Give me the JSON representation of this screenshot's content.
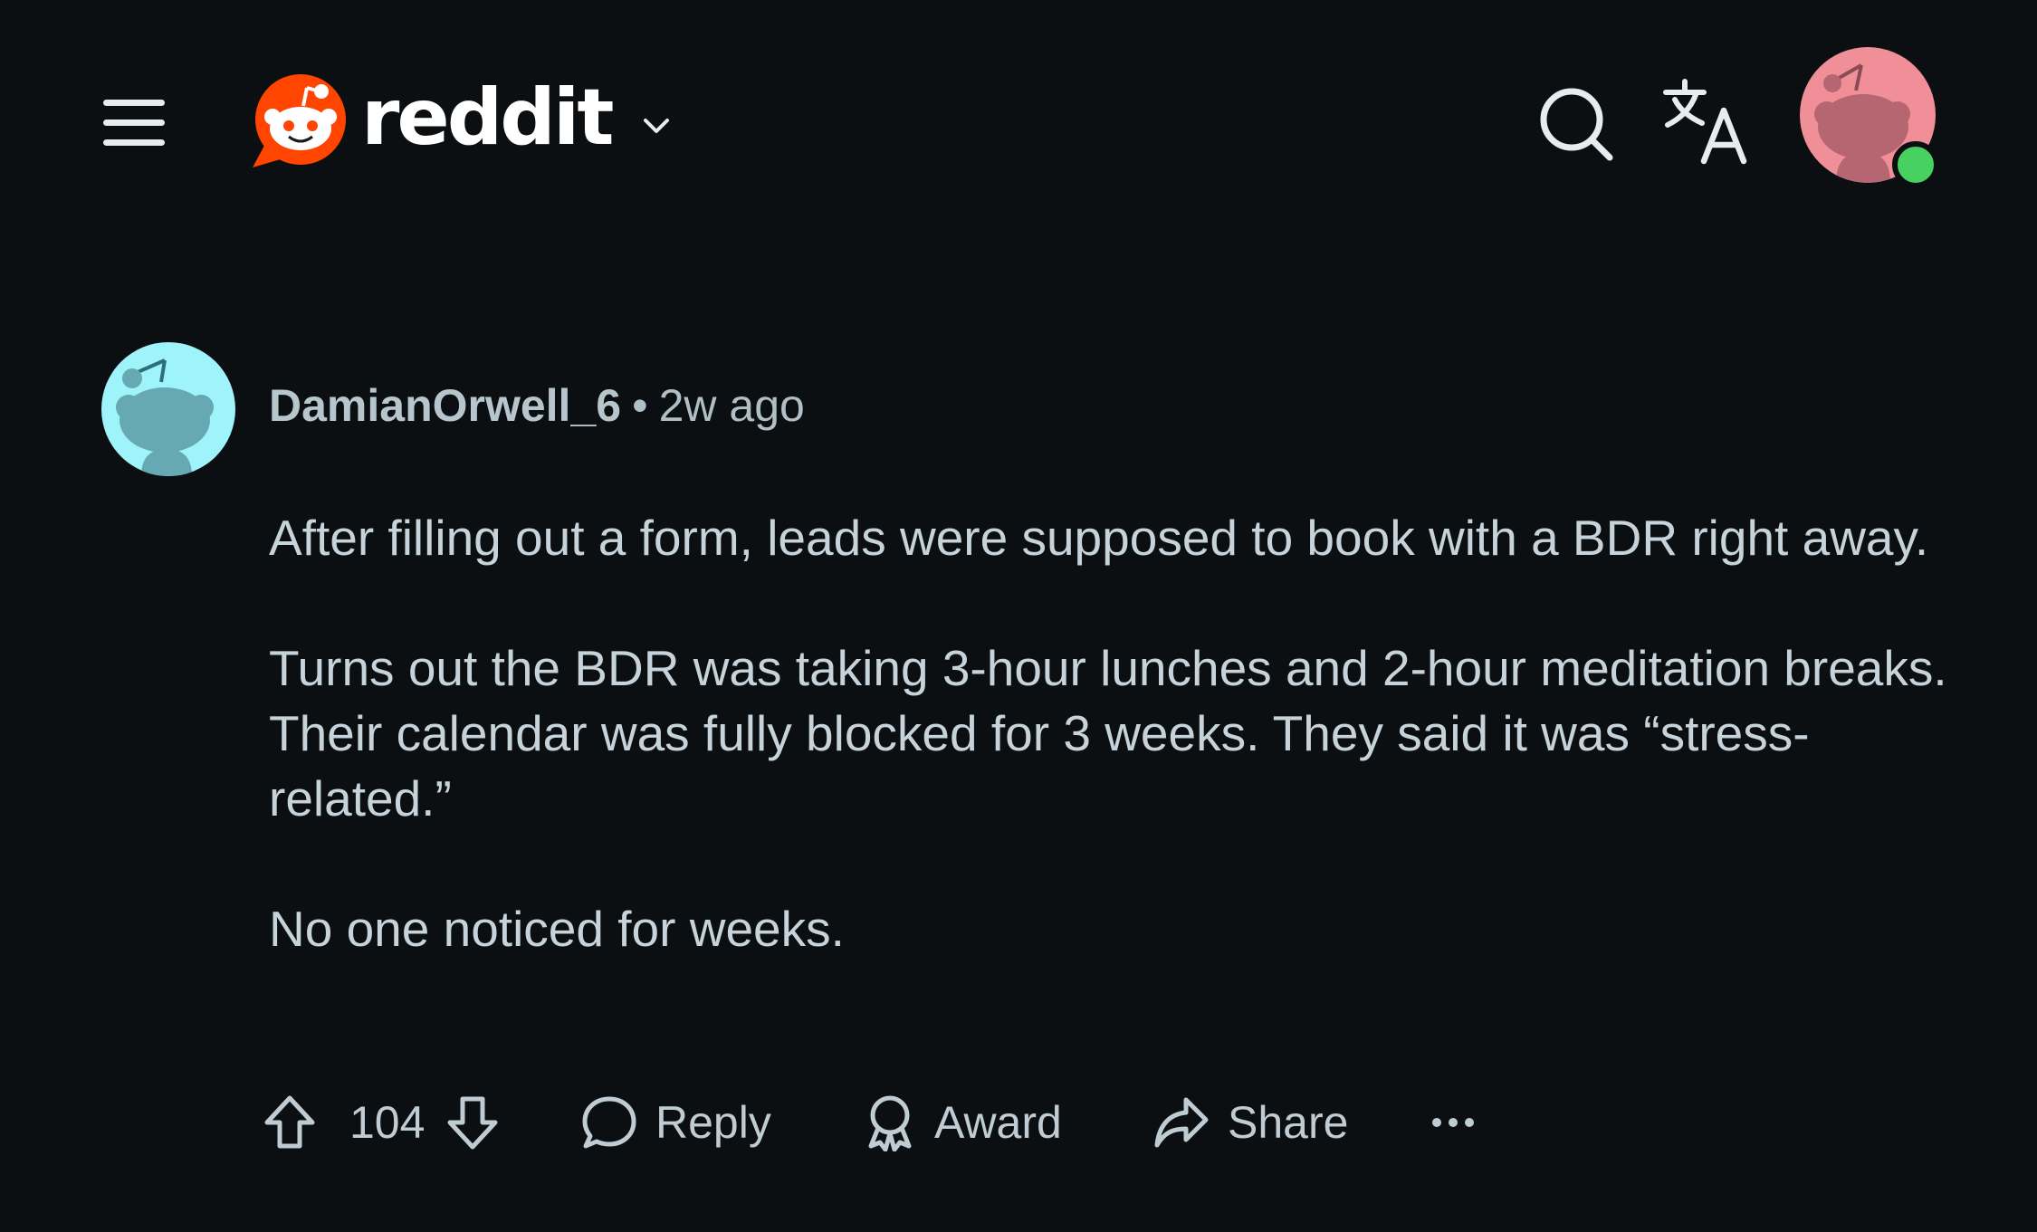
{
  "header": {
    "logo_text": "reddit",
    "brand_color": "#ff4500",
    "icons": [
      "menu-icon",
      "reddit-logo-icon",
      "chevron-down-icon",
      "search-icon",
      "translate-icon",
      "user-avatar",
      "online-status-dot"
    ],
    "avatar_color": "#f08f97",
    "online_color": "#46d160"
  },
  "comment": {
    "username": "DamianOrwell_6",
    "separator": "•",
    "timestamp": "2w ago",
    "avatar_color": "#9ff3fb",
    "paragraphs": [
      "After filling out a form, leads were supposed to book with a BDR right away.",
      "Turns out the BDR was taking 3-hour lunches and 2-hour meditation breaks. Their calendar was fully blocked for 3 weeks. They said it was “stress-related.”",
      "No one noticed for weeks."
    ],
    "actions": {
      "vote_count": "104",
      "reply_label": "Reply",
      "award_label": "Award",
      "share_label": "Share"
    }
  },
  "colors": {
    "background": "#0b0f12",
    "text": "#c7d3da"
  }
}
